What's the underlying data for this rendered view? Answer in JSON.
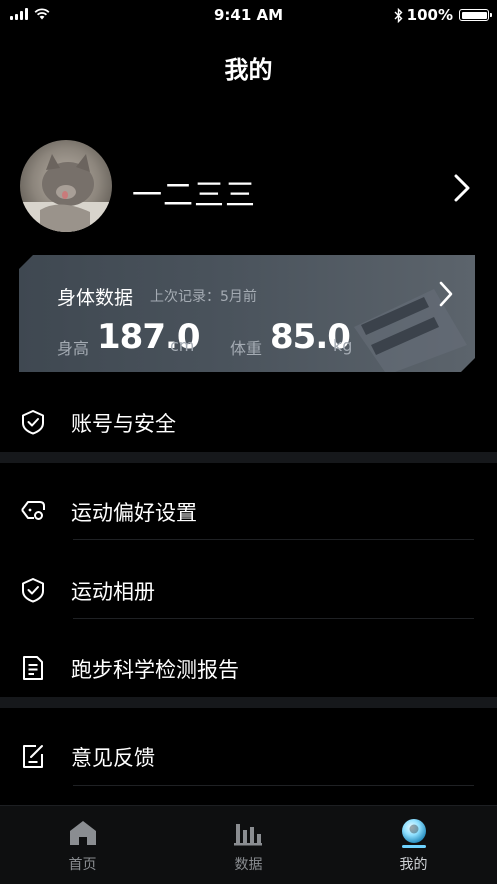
{
  "status_bar": {
    "time": "9:41 AM",
    "battery": "100%"
  },
  "header": {
    "title": "我的"
  },
  "profile": {
    "username": "一二三三"
  },
  "body_data": {
    "title": "身体数据",
    "last_record": "上次记录：5月前",
    "height_label": "身高",
    "height_value": "187.0",
    "height_unit": "cm",
    "weight_label": "体重",
    "weight_value": "85.0",
    "weight_unit": "kg"
  },
  "menu": {
    "account_security": "账号与安全",
    "sport_preferences": "运动偏好设置",
    "sport_album": "运动相册",
    "running_report": "跑步科学检测报告",
    "feedback": "意见反馈"
  },
  "tabbar": {
    "tabs": [
      {
        "label": "首页",
        "icon": "home-icon"
      },
      {
        "label": "数据",
        "icon": "chart-icon"
      },
      {
        "label": "我的",
        "icon": "user-icon"
      }
    ],
    "active": "我的"
  },
  "colors": {
    "background": "#000000",
    "card": "#4a535c",
    "separator": "#16181b",
    "active_tab": "#6fd3ff"
  }
}
